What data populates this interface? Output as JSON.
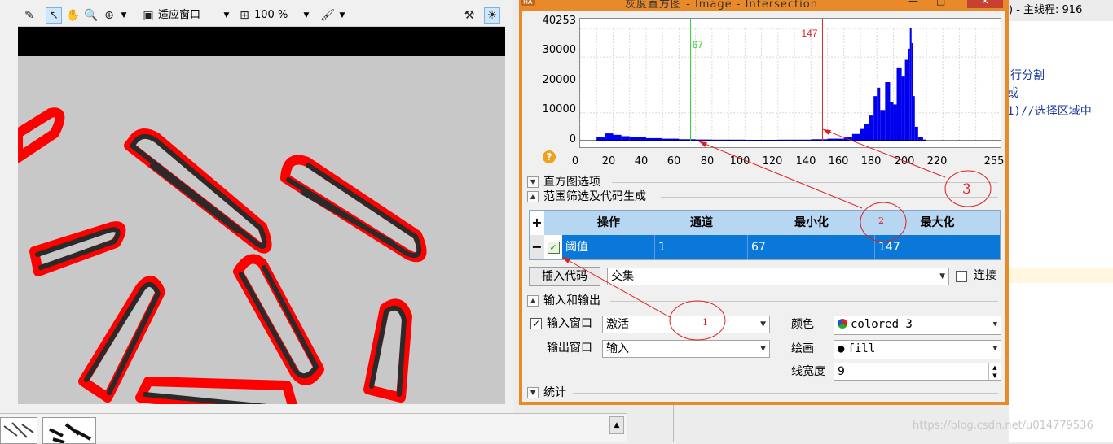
{
  "graphics_window": {
    "zoom_fit_label": "适应窗口",
    "zoom_percent": "100 %"
  },
  "editor": {
    "title_text": ") - 主线程: 916",
    "lines": [
      "行分割",
      "或",
      " 1)//选择区域中"
    ]
  },
  "watermark": "https://blog.csdn.net/u014779536",
  "dialog": {
    "title": "灰度直方图 - Image - Intersection",
    "logo": "HA",
    "help": "?",
    "histogram": {
      "y_ticks": [
        "40253",
        "30000",
        "20000",
        "10000",
        "0"
      ],
      "x_ticks": [
        "0",
        "20",
        "40",
        "60",
        "80",
        "100",
        "120",
        "140",
        "160",
        "180",
        "200",
        "220",
        "255"
      ],
      "green_marker_label": "67",
      "red_marker_label": "147"
    },
    "sections": {
      "histogram_options": "直方图选项",
      "range_filter": "范围筛选及代码生成",
      "io": "输入和输出",
      "stats": "统计"
    },
    "grid": {
      "add": "+",
      "remove": "−",
      "headers": [
        "操作",
        "通道",
        "最小化",
        "最大化"
      ],
      "row": [
        "阈值",
        "1",
        "67",
        "147"
      ]
    },
    "insert_code_button": "插入代码",
    "combine_mode": "交集",
    "connect_label": "连接",
    "input_window_label": "输入窗口",
    "input_window_value": "激活",
    "output_window_label": "输出窗口",
    "output_window_value": "输入",
    "color_label": "颜色",
    "color_value": "colored 3",
    "draw_label": "绘画",
    "draw_value": "fill",
    "line_width_label": "线宽度",
    "line_width_value": "9"
  },
  "annotations": [
    "1",
    "2",
    "3"
  ],
  "chart_data": {
    "type": "bar",
    "title": "",
    "xlim": [
      0,
      255
    ],
    "ylim": [
      0,
      40253
    ],
    "thresholds": {
      "min": 67,
      "max": 147
    },
    "x": [
      10,
      15,
      20,
      25,
      30,
      40,
      50,
      60,
      70,
      80,
      100,
      120,
      140,
      150,
      160,
      165,
      170,
      172,
      175,
      178,
      180,
      182,
      185,
      188,
      190,
      192,
      195,
      197,
      199,
      200,
      201,
      202,
      203,
      205,
      208,
      210
    ],
    "values": [
      1200,
      2600,
      2100,
      1600,
      1300,
      900,
      700,
      500,
      400,
      350,
      300,
      350,
      500,
      700,
      1200,
      2400,
      4200,
      6000,
      9000,
      16000,
      19000,
      11000,
      21000,
      14000,
      13000,
      26000,
      23000,
      29000,
      33000,
      40253,
      35000,
      16000,
      5000,
      1200,
      400,
      100
    ]
  }
}
